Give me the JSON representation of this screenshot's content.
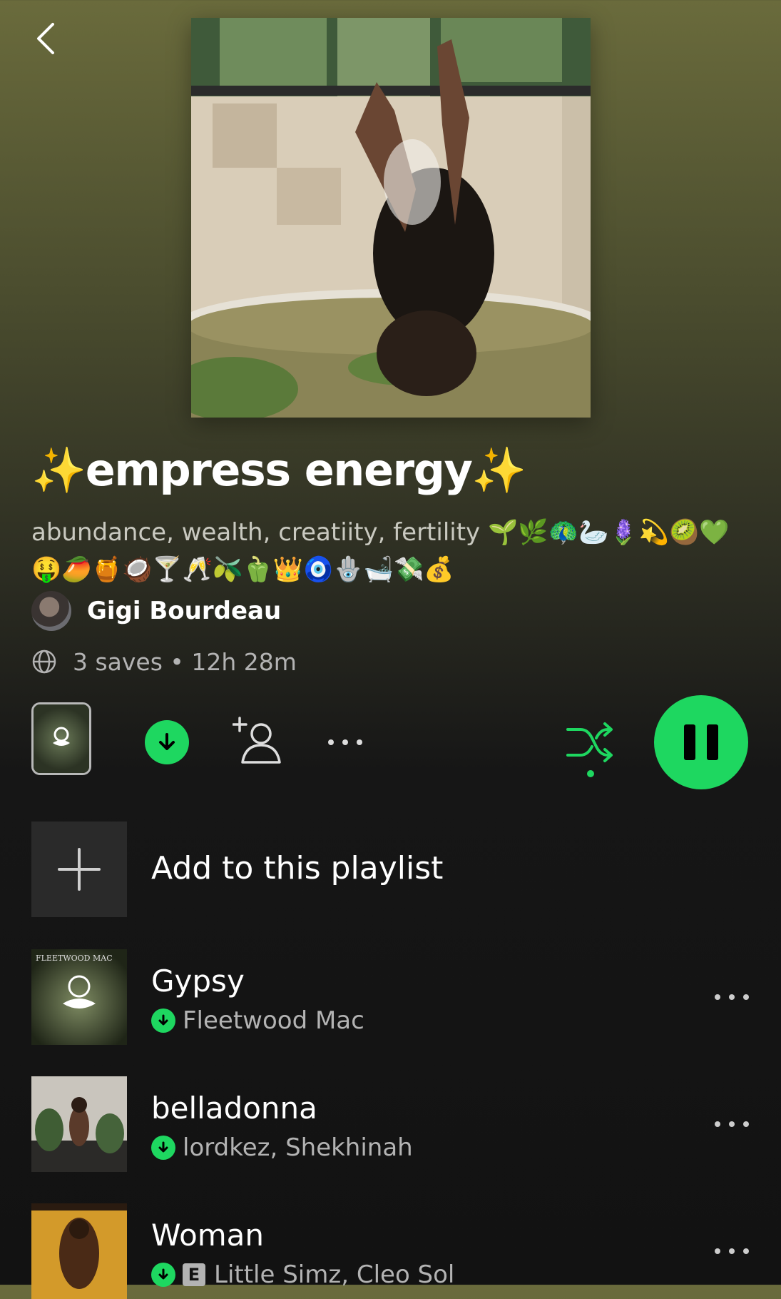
{
  "playlist": {
    "title_text": "empress energy",
    "title_sparkle": "✨",
    "description": "abundance, wealth, creatiity, fertility 🌱🌿🦚🦢🪻💫🥝💚🤑🥭🍯🥥🍸🥂🫒🫑👑🧿🪬🛁💸💰",
    "owner_name": "Gigi Bourdeau",
    "meta": "3 saves • 12h 28m"
  },
  "icons": {
    "back": "chevron-left-icon",
    "globe": "globe-icon",
    "download": "download-icon",
    "add_user": "add-user-icon",
    "more": "more-horizontal-icon",
    "shuffle": "shuffle-icon",
    "pause": "pause-icon",
    "plus": "plus-icon"
  },
  "colors": {
    "accent": "#1ed760",
    "background": "#121212",
    "header_tint": "#6a6b3c",
    "secondary_text": "#b3b3b3"
  },
  "add_row": {
    "label": "Add to this playlist"
  },
  "tracks": [
    {
      "title": "Gypsy",
      "artist": "Fleetwood Mac",
      "downloaded": true,
      "explicit": false,
      "cover_text": "FLEETWOOD MAC"
    },
    {
      "title": "belladonna",
      "artist": "lordkez, Shekhinah",
      "downloaded": true,
      "explicit": false
    },
    {
      "title": "Woman",
      "artist": "Little Simz, Cleo Sol",
      "downloaded": true,
      "explicit": true,
      "explicit_label": "E"
    }
  ]
}
